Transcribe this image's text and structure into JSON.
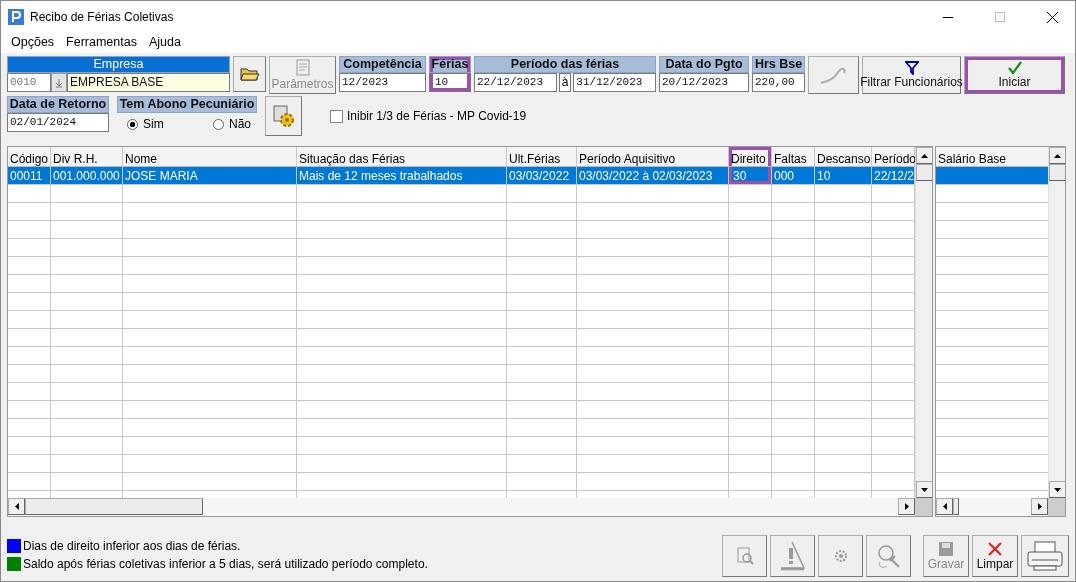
{
  "window": {
    "title": "Recibo de Férias Coletivas"
  },
  "menu": [
    {
      "label": "Opções"
    },
    {
      "label": "Ferramentas"
    },
    {
      "label": "Ajuda"
    }
  ],
  "toolbar": [
    {
      "kind": "empresa",
      "label": "Empresa",
      "code": "0010",
      "name": "EMPRESA BASE"
    },
    {
      "kind": "folder"
    },
    {
      "kind": "params",
      "label": "Parâmetros",
      "disabled": true
    },
    {
      "kind": "field",
      "label": "Competência",
      "value": "12/2023",
      "highlighted": false
    },
    {
      "kind": "field",
      "label": "Férias",
      "value": "10",
      "highlighted": true
    },
    {
      "kind": "period",
      "label": "Período das férias",
      "start": "22/12/2023",
      "separator": "à",
      "end": "31/12/2023"
    },
    {
      "kind": "field",
      "label": "Data do Pgto",
      "value": "20/12/2023",
      "highlighted": false
    },
    {
      "kind": "field",
      "label": "Hrs Bse",
      "value": "220,00",
      "highlighted": false
    },
    {
      "kind": "curve"
    },
    {
      "kind": "filter",
      "label": "Filtrar Funcionários",
      "highlighted": false
    },
    {
      "kind": "start",
      "label": "Iniciar",
      "highlighted": true
    }
  ],
  "options_row": {
    "retorno": {
      "label": "Data de Retorno",
      "value": "02/01/2024"
    },
    "abono": {
      "label": "Tem Abono Pecuniário",
      "options": [
        {
          "label": "Sim",
          "selected": true
        },
        {
          "label": "Não",
          "selected": false
        }
      ]
    },
    "covid": {
      "label": "Inibir 1/3 de Férias - MP Covid-19",
      "checked": false
    }
  },
  "table": {
    "columns": [
      {
        "label": "Código",
        "highlighted": false
      },
      {
        "label": "Div R.H.",
        "highlighted": false
      },
      {
        "label": "Nome",
        "highlighted": false
      },
      {
        "label": "Situação das Férias",
        "highlighted": false
      },
      {
        "label": "Ult.Férias",
        "highlighted": false
      },
      {
        "label": "Período Aquisitivo",
        "highlighted": false
      },
      {
        "label": "Direito",
        "highlighted": true
      },
      {
        "label": "Faltas",
        "highlighted": false
      },
      {
        "label": "Descanso",
        "highlighted": false
      },
      {
        "label": "Período",
        "highlighted": false
      }
    ],
    "rows": [
      {
        "selected": true,
        "cells": [
          "00011",
          "001.000.000",
          "JOSE MARIA",
          "Mais de 12 meses trabalhados",
          "03/03/2022",
          "03/03/2022 à 02/03/2023",
          "30",
          "000",
          "10",
          "22/12/2"
        ]
      }
    ]
  },
  "side_table": {
    "columns": [
      {
        "label": "Salário Base"
      }
    ],
    "rows": [
      {
        "selected": true
      }
    ]
  },
  "legend": [
    {
      "color": "#0000ff",
      "text": "Dias de direito inferior aos dias de férias."
    },
    {
      "color": "#008000",
      "text": "Saldo após férias coletivas inferior a 5 dias, será utilizado período completo."
    }
  ],
  "bottom_buttons": [
    {
      "kind": "preview",
      "disabled": true
    },
    {
      "kind": "warning",
      "disabled": true
    },
    {
      "kind": "settings",
      "disabled": true
    },
    {
      "kind": "search-tool",
      "disabled": true
    },
    {
      "kind": "save",
      "label": "Gravar",
      "disabled": true
    },
    {
      "kind": "clear",
      "label": "Limpar",
      "disabled": false
    },
    {
      "kind": "print",
      "disabled": false
    }
  ]
}
